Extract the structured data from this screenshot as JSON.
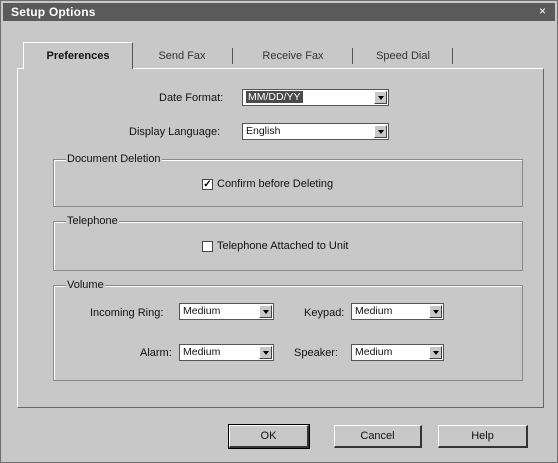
{
  "window": {
    "title": "Setup Options",
    "close_glyph": "×"
  },
  "tabs": [
    {
      "label": "Preferences",
      "active": true
    },
    {
      "label": "Send Fax"
    },
    {
      "label": "Receive Fax"
    },
    {
      "label": "Speed Dial"
    }
  ],
  "preferences": {
    "date_format": {
      "label": "Date Format:",
      "value": "MM/DD/YY"
    },
    "display_language": {
      "label": "Display Language:",
      "value": "English"
    }
  },
  "document_deletion": {
    "title": "Document Deletion",
    "confirm_label": "Confirm before Deleting",
    "confirm_checked": true
  },
  "telephone": {
    "title": "Telephone",
    "attached_label": "Telephone Attached to Unit",
    "attached_checked": false
  },
  "volume": {
    "title": "Volume",
    "incoming_ring": {
      "label": "Incoming Ring:",
      "value": "Medium"
    },
    "keypad": {
      "label": "Keypad:",
      "value": "Medium"
    },
    "alarm": {
      "label": "Alarm:",
      "value": "Medium"
    },
    "speaker": {
      "label": "Speaker:",
      "value": "Medium"
    }
  },
  "buttons": {
    "ok": "OK",
    "cancel": "Cancel",
    "help": "Help"
  },
  "check_glyph": "✓"
}
